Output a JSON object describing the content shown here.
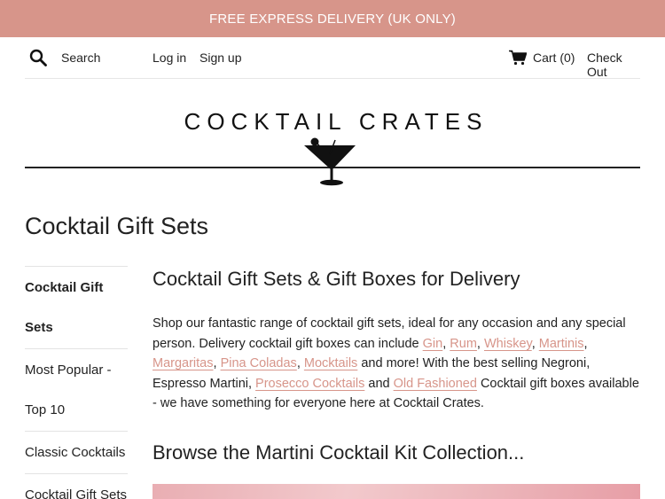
{
  "announcement": "FREE EXPRESS DELIVERY (UK ONLY)",
  "nav": {
    "search_label": "Search",
    "login": "Log in",
    "signup": "Sign up",
    "cart": "Cart (0)",
    "checkout": "Check Out"
  },
  "logo": {
    "text": "COCKTAIL CRATES"
  },
  "page_title": "Cocktail Gift Sets",
  "sidebar": {
    "items": [
      {
        "label": "Cocktail Gift"
      },
      {
        "label": "Sets"
      },
      {
        "label": "Most Popular -"
      },
      {
        "label": "Top 10"
      },
      {
        "label": "Classic Cocktails"
      },
      {
        "label": "Cocktail Gift Sets"
      }
    ]
  },
  "main": {
    "heading": "Cocktail Gift Sets & Gift Boxes for Delivery",
    "intro_1": "Shop our fantastic range of cocktail gift sets, ideal for any occasion and any special person. Delivery cocktail gift boxes can include",
    "links": [
      "Gin",
      "Rum",
      "Whiskey",
      "Martinis",
      "Margaritas",
      "Pina Coladas",
      "Mocktails",
      "Prosecco Cocktails",
      "Old Fashioned"
    ],
    "sep_comma": ",",
    "text_and_more": "and more! With the best selling Negroni, Espresso Martini,",
    "text_and": "and",
    "text_tail": "Cocktail gift boxes available - we have something for everyone here at Cocktail Crates.",
    "subheading": "Browse the Martini Cocktail Kit Collection..."
  },
  "colors": {
    "accent": "#d7958a",
    "banner_pink": "#ecb5ba"
  }
}
